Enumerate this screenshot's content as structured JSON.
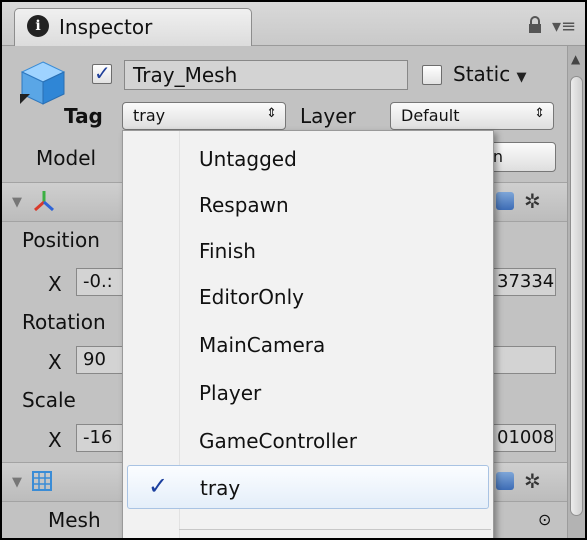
{
  "window": {
    "tab_title": "Inspector",
    "menu_glyph": "▾≡"
  },
  "gameobject": {
    "active": true,
    "name": "Tray_Mesh",
    "static_label": "Static",
    "static_checked": false,
    "tag_label": "Tag",
    "tag_value": "tray",
    "layer_label": "Layer",
    "layer_value": "Default",
    "model_label": "Model",
    "open_button_partial": "en"
  },
  "transform": {
    "position_label": "Position",
    "rotation_label": "Rotation",
    "scale_label": "Scale",
    "x_label": "X",
    "position_x": "-0.:",
    "position_right": "37334",
    "rotation_x": "90",
    "scale_x": "-16",
    "scale_right": "01008"
  },
  "mesh_section": {
    "label": "Mesh",
    "target_glyph": "⊙"
  },
  "tag_dropdown": {
    "items": [
      {
        "label": "Untagged",
        "selected": false
      },
      {
        "label": "Respawn",
        "selected": false
      },
      {
        "label": "Finish",
        "selected": false
      },
      {
        "label": "EditorOnly",
        "selected": false
      },
      {
        "label": "MainCamera",
        "selected": false
      },
      {
        "label": "Player",
        "selected": false
      },
      {
        "label": "GameController",
        "selected": false
      },
      {
        "label": "tray",
        "selected": true
      }
    ],
    "check_glyph": "✓"
  },
  "glyphs": {
    "foldout": "▼",
    "caret_down": "▼",
    "updown": "⇕",
    "cog": "✲",
    "scroll_up": "▲"
  },
  "colors": {
    "selection_border": "#a9c3e3",
    "check": "#1b3f9e",
    "background": "#c2c2c2"
  }
}
